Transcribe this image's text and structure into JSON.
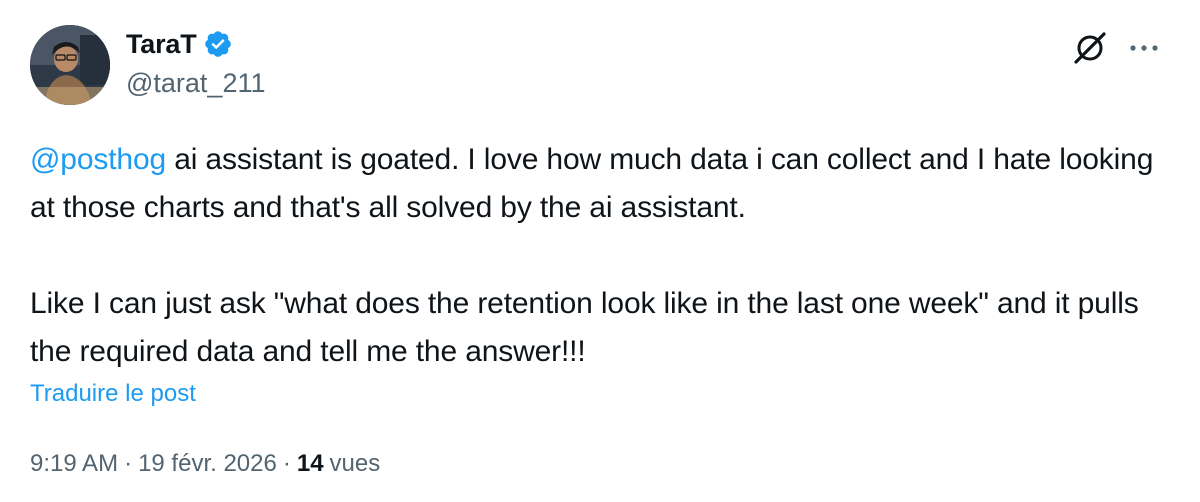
{
  "author": {
    "display_name": "TaraT",
    "handle": "@tarat_211",
    "verified_icon": "verified-badge-icon"
  },
  "header_icons": {
    "grok": "grok-icon",
    "more": "more-dots-icon"
  },
  "post": {
    "mention": "@posthog",
    "line1_rest": " ai assistant is goated. I love how much data i can collect and I hate looking at those charts and that's all solved by the ai assistant.",
    "paragraph2": "Like I can just ask \"what does the retention look like in the last one week\" and it pulls the required data and tell me the answer!!!"
  },
  "translate_label": "Traduire le post",
  "meta": {
    "time": "9:19 AM",
    "separator1": "·",
    "date": "19 févr. 2026",
    "separator2": "·",
    "views_count": "14",
    "views_label": "vues"
  },
  "colors": {
    "accent": "#1d9bf0",
    "text": "#0f1419",
    "muted": "#536471"
  }
}
